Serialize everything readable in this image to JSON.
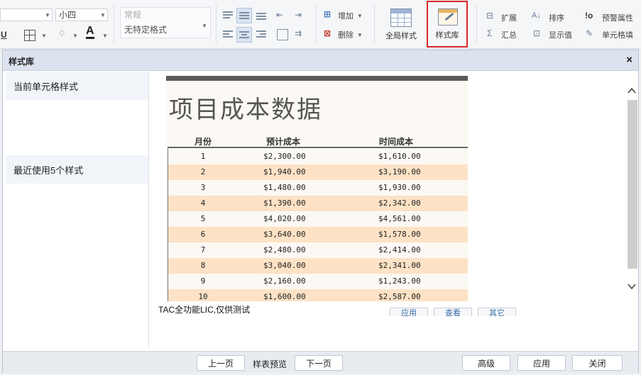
{
  "ribbon": {
    "font_size": "小四",
    "number_format_top": "常规",
    "number_format": "无特定格式",
    "insert_label": "增加",
    "delete_label": "删除",
    "global_style_label": "全局样式",
    "style_library_label": "样式库",
    "expand_label": "扩展",
    "sort_label": "排序",
    "alert_prop_label": "预警属性",
    "summary_label": "汇总",
    "show_value_label": "显示值",
    "cell_fill_label": "单元格填",
    "highlight_color": "#d9262b"
  },
  "dialog": {
    "title": "样式库",
    "close": "×",
    "left_items": [
      "当前单元格样式",
      "最近使用5个样式"
    ],
    "watermark": "TAC全功能LIC,仅供测试",
    "hidden_buttons": [
      "应用",
      "查看",
      "其它"
    ]
  },
  "report": {
    "title": "项目成本数据",
    "headers": [
      "月份",
      "预计成本",
      "时间成本"
    ],
    "rows": [
      [
        "1",
        "$2,300.00",
        "$1,610.00"
      ],
      [
        "2",
        "$1,940.00",
        "$3,190.00"
      ],
      [
        "3",
        "$1,480.00",
        "$1,930.00"
      ],
      [
        "4",
        "$1,390.00",
        "$2,342.00"
      ],
      [
        "5",
        "$4,020.00",
        "$4,561.00"
      ],
      [
        "6",
        "$3,640.00",
        "$1,578.00"
      ],
      [
        "7",
        "$2,480.00",
        "$2,414.00"
      ],
      [
        "8",
        "$3,040.00",
        "$2,341.00"
      ],
      [
        "9",
        "$2,160.00",
        "$1,243.00"
      ],
      [
        "10",
        "$1,600.00",
        "$2,587.00"
      ]
    ],
    "row_alt_color": "#fde2c5",
    "sheet_bg": "#fcf9f4"
  },
  "footer": {
    "prev": "上一页",
    "preview": "样表预览",
    "next": "下一页",
    "advanced": "高级",
    "apply": "应用",
    "close": "关闭"
  }
}
